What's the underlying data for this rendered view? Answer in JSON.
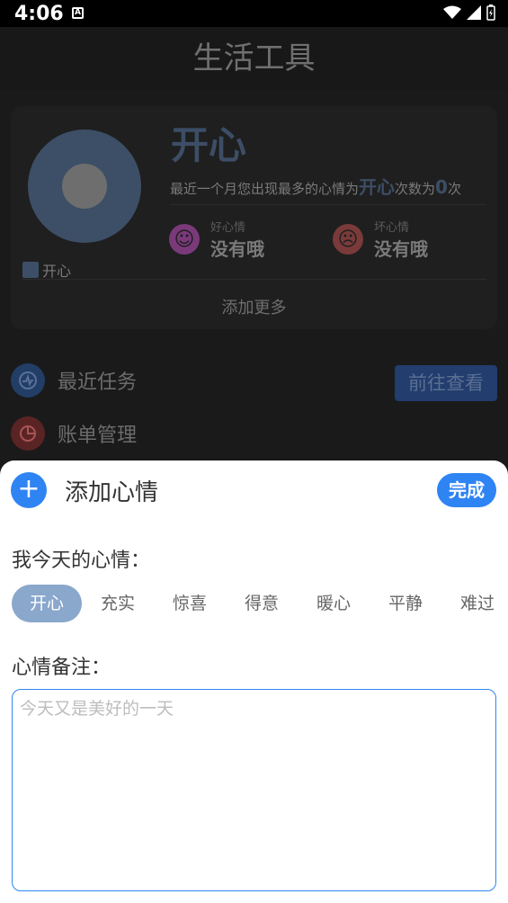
{
  "status_bar": {
    "time": "4:06",
    "notif_icon_letter": "A"
  },
  "header": {
    "title": "生活工具"
  },
  "mood_card": {
    "big_mood": "开心",
    "summary_prefix": "最近一个月您出现最多的心情为",
    "summary_mood": "开心",
    "summary_middle": "次数为",
    "summary_count": "0",
    "summary_suffix": "次",
    "legend_label": "开心",
    "good_mood": {
      "label": "好心情",
      "value": "没有哦",
      "color": "#7a3a7a"
    },
    "bad_mood": {
      "label": "坏心情",
      "value": "没有哦",
      "color": "#7a3a3a"
    },
    "add_more": "添加更多"
  },
  "menu": {
    "recent_tasks": "最近任务",
    "bill_manage": "账单管理",
    "goto_button": "前往查看"
  },
  "sheet": {
    "title": "添加心情",
    "done_button": "完成",
    "today_label": "我今天的心情：",
    "moods": [
      "开心",
      "充实",
      "惊喜",
      "得意",
      "暖心",
      "平静",
      "难过"
    ],
    "selected_mood": "开心",
    "note_label": "心情备注：",
    "note_placeholder": "今天又是美好的一天",
    "accent": "#2f84f4"
  }
}
